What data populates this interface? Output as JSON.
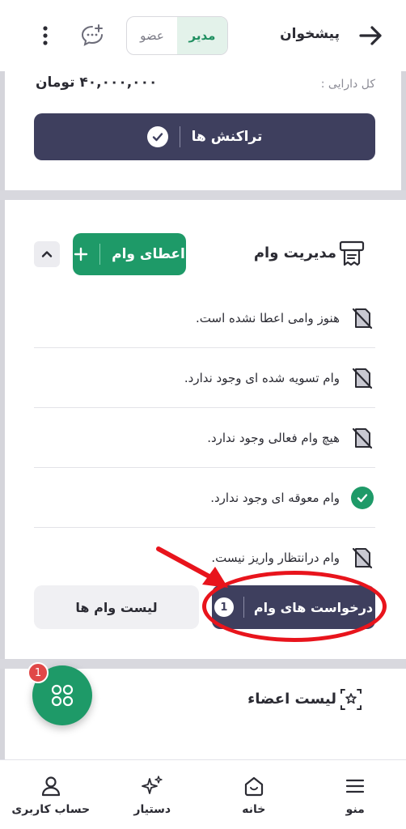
{
  "header": {
    "title": "پیشخوان",
    "role_manager": "مدیر",
    "role_member": "عضو",
    "back_icon": "arrow-right-icon",
    "chat_icon": "chat-add-icon",
    "menu_icon": "kebab-menu-icon"
  },
  "assets": {
    "label": "کل دارایی :",
    "value": "۴۰,۰۰۰,۰۰۰ تومان"
  },
  "transactions_button": "تراکنش ها",
  "loan_management": {
    "title": "مدیریت وام",
    "grant_button": "اعطای وام",
    "statuses": [
      {
        "text": "هنوز وامی اعطا نشده است.",
        "icon": "no-document-icon"
      },
      {
        "text": "وام تسویه شده ای وجود ندارد.",
        "icon": "no-document-icon"
      },
      {
        "text": "هیچ وام فعالی وجود ندارد.",
        "icon": "no-document-icon"
      },
      {
        "text": "وام معوقه ای وجود ندارد.",
        "icon": "check-circle-icon"
      },
      {
        "text": "وام درانتظار واریز نیست.",
        "icon": "no-document-icon"
      }
    ],
    "requests_button": "درخواست های وام",
    "requests_count": "1",
    "list_button": "لیست وام ها"
  },
  "members": {
    "title": "لیست اعضاء"
  },
  "fab": {
    "badge": "1"
  },
  "bottom_nav": {
    "menu": "منو",
    "home": "خانه",
    "assistant": "دستیار",
    "account": "حساب کاربری"
  },
  "colors": {
    "primary_dark": "#3e3f5e",
    "green": "#1e9a68",
    "annotation_red": "#e8141c"
  }
}
